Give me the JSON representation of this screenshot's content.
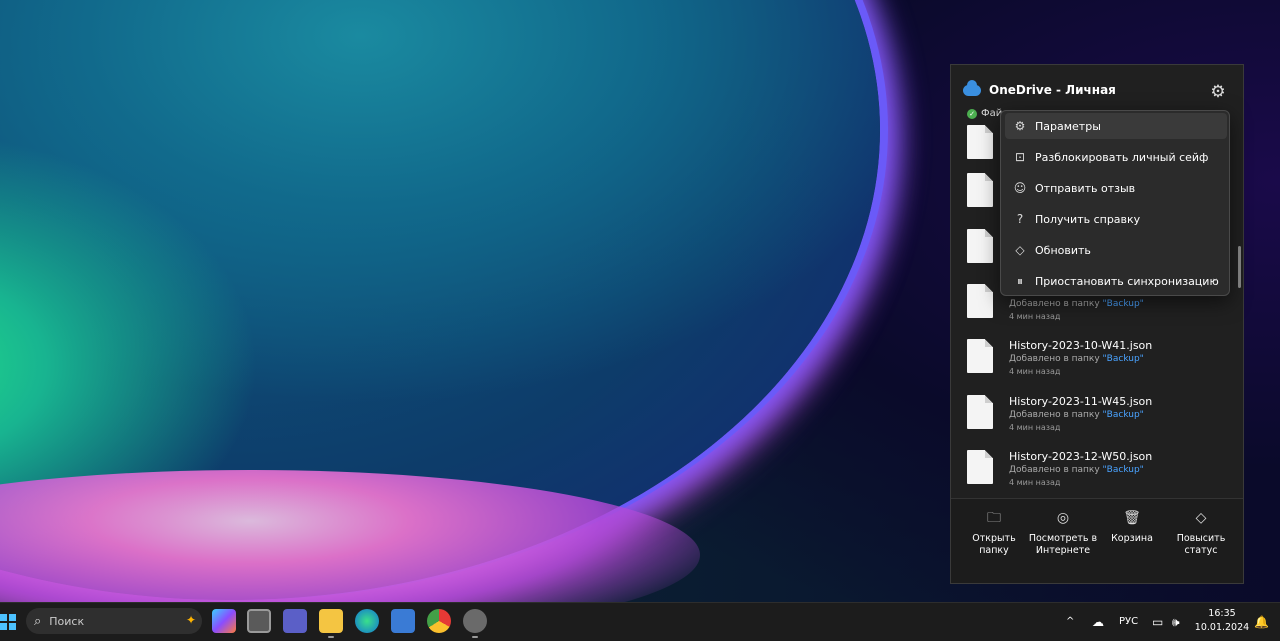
{
  "panel": {
    "title": "OneDrive - Личная",
    "status": "Фай"
  },
  "menu": {
    "items": [
      {
        "icon": "gear-icon",
        "glyph": "⚙",
        "label": "Параметры"
      },
      {
        "icon": "lock-icon",
        "glyph": "🔓",
        "label": "Разблокировать личный сейф"
      },
      {
        "icon": "feedback-icon",
        "glyph": "☺",
        "label": "Отправить отзыв"
      },
      {
        "icon": "help-icon",
        "glyph": "?",
        "label": "Получить справку"
      },
      {
        "icon": "diamond-icon",
        "glyph": "◇",
        "label": "Обновить"
      },
      {
        "icon": "pause-icon",
        "glyph": "⏸",
        "label": "Приостановить синхронизацию"
      }
    ]
  },
  "files": [
    {
      "name": "",
      "added": "Добавлено в папку",
      "folder": "\"Backup\"",
      "time": "4 мин назад"
    },
    {
      "name": "History-2023-10-W41.json",
      "added": "Добавлено в папку",
      "folder": "\"Backup\"",
      "time": "4 мин назад"
    },
    {
      "name": "History-2023-11-W45.json",
      "added": "Добавлено в папку",
      "folder": "\"Backup\"",
      "time": "4 мин назад"
    },
    {
      "name": "History-2023-12-W50.json",
      "added": "Добавлено в папку",
      "folder": "\"Backup\"",
      "time": "4 мин назад"
    }
  ],
  "footer": {
    "open_folder": "Открыть папку",
    "view_online": "Посмотреть в Интернете",
    "recycle": "Корзина",
    "upgrade": "Повысить статус"
  },
  "taskbar": {
    "search_placeholder": "Поиск",
    "language": "РУС",
    "time": "16:35",
    "date": "10.01.2024"
  },
  "colors": {
    "accent": "#4aa3ff",
    "panel_bg": "#202020",
    "menu_bg": "#2b2b2b",
    "status_ok": "#4caf50"
  }
}
